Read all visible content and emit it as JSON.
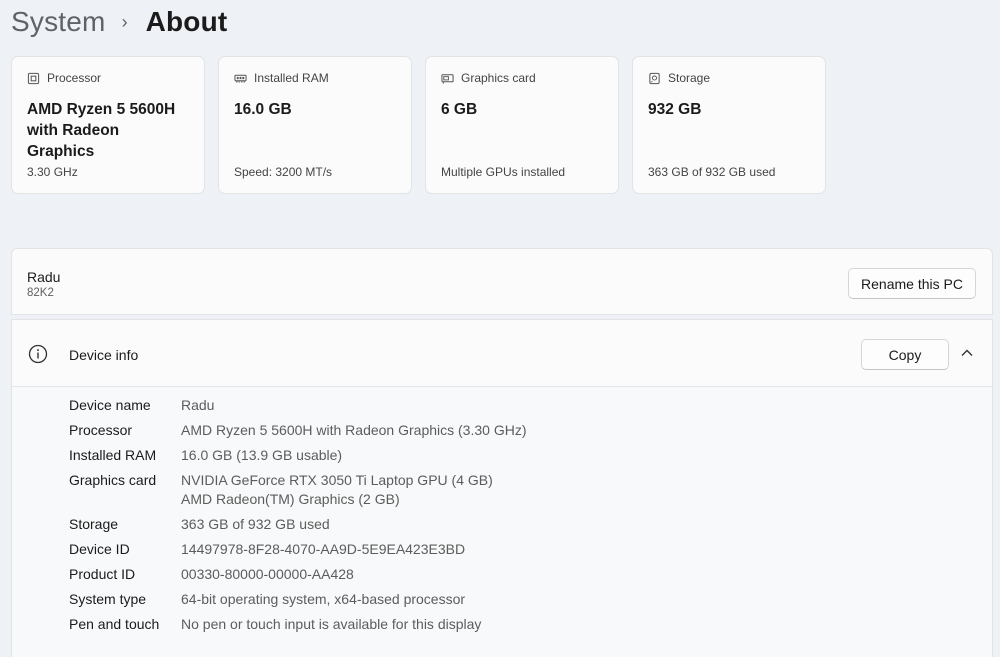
{
  "breadcrumb": {
    "parent": "System",
    "separator": "›",
    "current": "About"
  },
  "spec_cards": [
    {
      "icon": "processor-icon",
      "label": "Processor",
      "value": "AMD Ryzen 5 5600H with Radeon Graphics",
      "sub": "3.30 GHz"
    },
    {
      "icon": "ram-icon",
      "label": "Installed RAM",
      "value": "16.0 GB",
      "sub": "Speed: 3200 MT/s"
    },
    {
      "icon": "graphics-card-icon",
      "label": "Graphics card",
      "value": "6 GB",
      "sub": "Multiple GPUs installed"
    },
    {
      "icon": "storage-icon",
      "label": "Storage",
      "value": "932 GB",
      "sub": "363 GB of 932 GB used"
    }
  ],
  "pc": {
    "name": "Radu",
    "model": "82K2",
    "rename_label": "Rename this PC"
  },
  "device_info": {
    "title": "Device info",
    "copy_label": "Copy",
    "rows": [
      {
        "label": "Device name",
        "values": [
          "Radu"
        ]
      },
      {
        "label": "Processor",
        "values": [
          "AMD Ryzen 5 5600H with Radeon Graphics (3.30 GHz)"
        ]
      },
      {
        "label": "Installed RAM",
        "values": [
          "16.0 GB (13.9 GB usable)"
        ]
      },
      {
        "label": "Graphics card",
        "values": [
          "NVIDIA GeForce RTX 3050 Ti Laptop GPU (4 GB)",
          "AMD Radeon(TM) Graphics (2 GB)"
        ]
      },
      {
        "label": "Storage",
        "values": [
          "363 GB of 932 GB used"
        ]
      },
      {
        "label": "Device ID",
        "values": [
          "14497978-8F28-4070-AA9D-5E9EA423E3BD"
        ]
      },
      {
        "label": "Product ID",
        "values": [
          "00330-80000-00000-AA428"
        ]
      },
      {
        "label": "System type",
        "values": [
          "64-bit operating system, x64-based processor"
        ]
      },
      {
        "label": "Pen and touch",
        "values": [
          "No pen or touch input is available for this display"
        ]
      }
    ]
  }
}
